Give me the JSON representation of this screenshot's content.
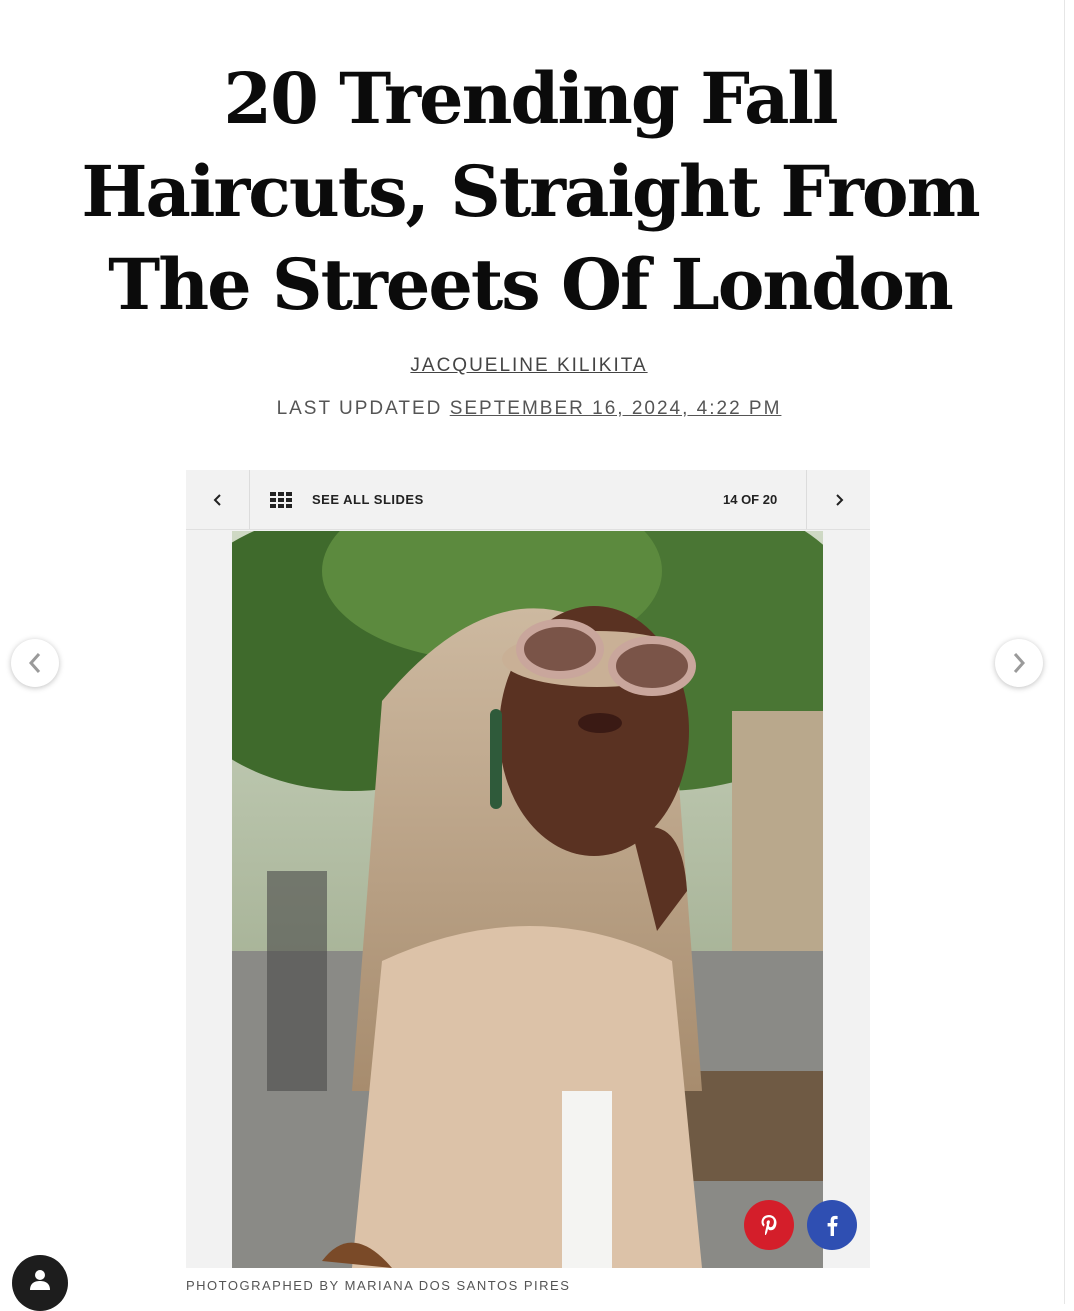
{
  "article": {
    "title": "20 Trending Fall Haircuts, Straight From The Streets Of London",
    "author": "JACQUELINE KILIKITA",
    "updated_label": "LAST UPDATED",
    "updated_date": "SEPTEMBER 16, 2024, 4:22 PM"
  },
  "slideshow": {
    "see_all_label": "SEE ALL SLIDES",
    "counter": "14 OF 20",
    "photo_credit": "PHOTOGRAPHED BY MARIANA DOS SANTOS PIRES"
  },
  "icons": {
    "prev_slide": "chevron-left-icon",
    "next_slide": "chevron-right-icon",
    "grid": "grid-icon",
    "pinterest": "pinterest-icon",
    "facebook": "facebook-icon",
    "avatar": "user-icon"
  },
  "colors": {
    "pinterest": "#d41e2a",
    "facebook": "#2f4fb2",
    "toolbar_bg": "#f2f2f2"
  }
}
